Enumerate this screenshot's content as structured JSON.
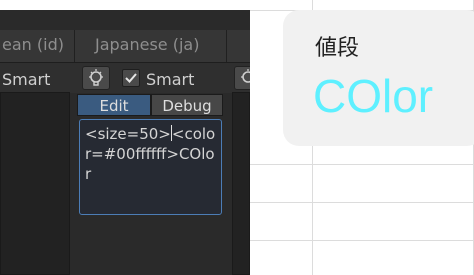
{
  "columns": {
    "left_header": "ean (id)",
    "mid_header": "Japanese (ja)"
  },
  "toolbar": {
    "left_smart_label": "Smart",
    "smart_label": "Smart",
    "smart_checked": true
  },
  "tabs": {
    "edit_label": "Edit",
    "debug_label": "Debug"
  },
  "editor": {
    "text_before_caret": "<size=50>",
    "text_after_caret": "<color=#00ffffff>COlor"
  },
  "preview": {
    "label": "値段",
    "value": "COlor",
    "value_color": "#5ef0ff"
  },
  "colors": {
    "panel_bg": "#2a2a2a",
    "accent_border": "#4c7db6",
    "tab_active": "#3a5b80"
  }
}
